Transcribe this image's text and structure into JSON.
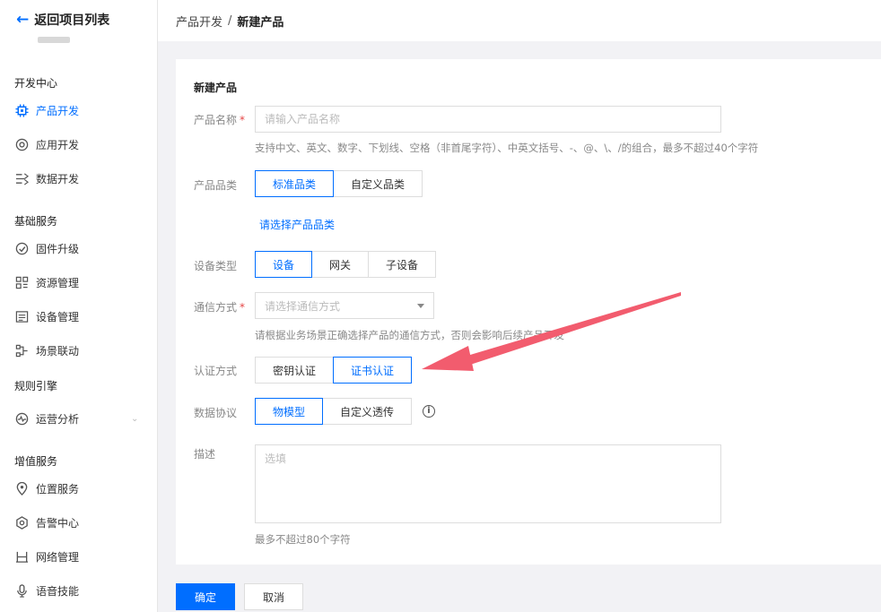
{
  "sidebar": {
    "back_label": "返回项目列表",
    "sections": {
      "dev_center": "开发中心",
      "basic_services": "基础服务",
      "rule_engine": "规则引擎",
      "value_added": "增值服务"
    },
    "items": [
      {
        "label": "产品开发",
        "icon": "chip-icon",
        "active": true
      },
      {
        "label": "应用开发",
        "icon": "app-icon"
      },
      {
        "label": "数据开发",
        "icon": "data-flow-icon"
      },
      {
        "label": "固件升级",
        "icon": "firmware-icon"
      },
      {
        "label": "资源管理",
        "icon": "resource-icon"
      },
      {
        "label": "设备管理",
        "icon": "device-icon"
      },
      {
        "label": "场景联动",
        "icon": "scene-icon"
      },
      {
        "label": "运营分析",
        "icon": "analytics-icon"
      },
      {
        "label": "位置服务",
        "icon": "location-icon"
      },
      {
        "label": "告警中心",
        "icon": "alarm-icon"
      },
      {
        "label": "网络管理",
        "icon": "network-icon"
      },
      {
        "label": "语音技能",
        "icon": "voice-icon"
      }
    ]
  },
  "breadcrumb": {
    "parent": "产品开发",
    "separator": "/",
    "current": "新建产品"
  },
  "form": {
    "title": "新建产品",
    "name": {
      "label": "产品名称",
      "required_mark": "*",
      "placeholder": "请输入产品名称",
      "hint": "支持中文、英文、数字、下划线、空格（非首尾字符）、中英文括号、-、@、\\、/的组合，最多不超过40个字符"
    },
    "category": {
      "label": "产品品类",
      "options": [
        "标准品类",
        "自定义品类"
      ],
      "selected": "标准品类",
      "select_link": "请选择产品品类"
    },
    "device_type": {
      "label": "设备类型",
      "options": [
        "设备",
        "网关",
        "子设备"
      ],
      "selected": "设备"
    },
    "comm": {
      "label": "通信方式",
      "required_mark": "*",
      "placeholder": "请选择通信方式",
      "hint": "请根据业务场景正确选择产品的通信方式，否则会影响后续产品开发"
    },
    "auth": {
      "label": "认证方式",
      "options": [
        "密钥认证",
        "证书认证"
      ],
      "selected": "证书认证"
    },
    "protocol": {
      "label": "数据协议",
      "options": [
        "物模型",
        "自定义透传"
      ],
      "selected": "物模型",
      "info_icon": "info-icon",
      "info_glyph": "i"
    },
    "desc": {
      "label": "描述",
      "placeholder": "选填",
      "hint": "最多不超过80个字符"
    }
  },
  "actions": {
    "confirm": "确定",
    "cancel": "取消"
  },
  "colors": {
    "accent": "#006eff",
    "required": "#e54545",
    "annotation_arrow": "#f25c6e"
  }
}
